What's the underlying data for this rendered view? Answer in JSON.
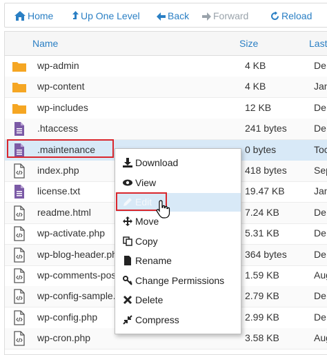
{
  "toolbar": {
    "home": "Home",
    "up": "Up One Level",
    "back": "Back",
    "forward": "Forward",
    "reload": "Reload"
  },
  "columns": {
    "name": "Name",
    "size": "Size",
    "last": "Last"
  },
  "files": [
    {
      "name": "wp-admin",
      "size": "4 KB",
      "date": "De",
      "type": "folder"
    },
    {
      "name": "wp-content",
      "size": "4 KB",
      "date": "Jan",
      "type": "folder"
    },
    {
      "name": "wp-includes",
      "size": "12 KB",
      "date": "De",
      "type": "folder"
    },
    {
      "name": ".htaccess",
      "size": "241 bytes",
      "date": "De",
      "type": "text"
    },
    {
      "name": ".maintenance",
      "size": "0 bytes",
      "date": "Toc",
      "type": "text"
    },
    {
      "name": "index.php",
      "size": "418 bytes",
      "date": "Sep",
      "type": "code"
    },
    {
      "name": "license.txt",
      "size": "19.47 KB",
      "date": "Jan",
      "type": "text"
    },
    {
      "name": "readme.html",
      "size": "7.24 KB",
      "date": "De",
      "type": "code"
    },
    {
      "name": "wp-activate.php",
      "size": "5.31 KB",
      "date": "De",
      "type": "code"
    },
    {
      "name": "wp-blog-header.php",
      "size": "364 bytes",
      "date": "De",
      "type": "code"
    },
    {
      "name": "wp-comments-post.php",
      "size": "1.59 KB",
      "date": "Aug",
      "type": "code"
    },
    {
      "name": "wp-config-sample.php",
      "size": "2.79 KB",
      "date": "De",
      "type": "code"
    },
    {
      "name": "wp-config.php",
      "size": "2.99 KB",
      "date": "De",
      "type": "code"
    },
    {
      "name": "wp-cron.php",
      "size": "3.58 KB",
      "date": "Aug",
      "type": "code"
    }
  ],
  "menu": {
    "download": "Download",
    "view": "View",
    "edit": "Edit",
    "move": "Move",
    "copy": "Copy",
    "rename": "Rename",
    "permissions": "Change Permissions",
    "delete": "Delete",
    "compress": "Compress"
  },
  "colors": {
    "accent": "#2a7fc4",
    "folder": "#f5a623",
    "text_file": "#7b5aa6",
    "highlight": "#d9262c"
  }
}
